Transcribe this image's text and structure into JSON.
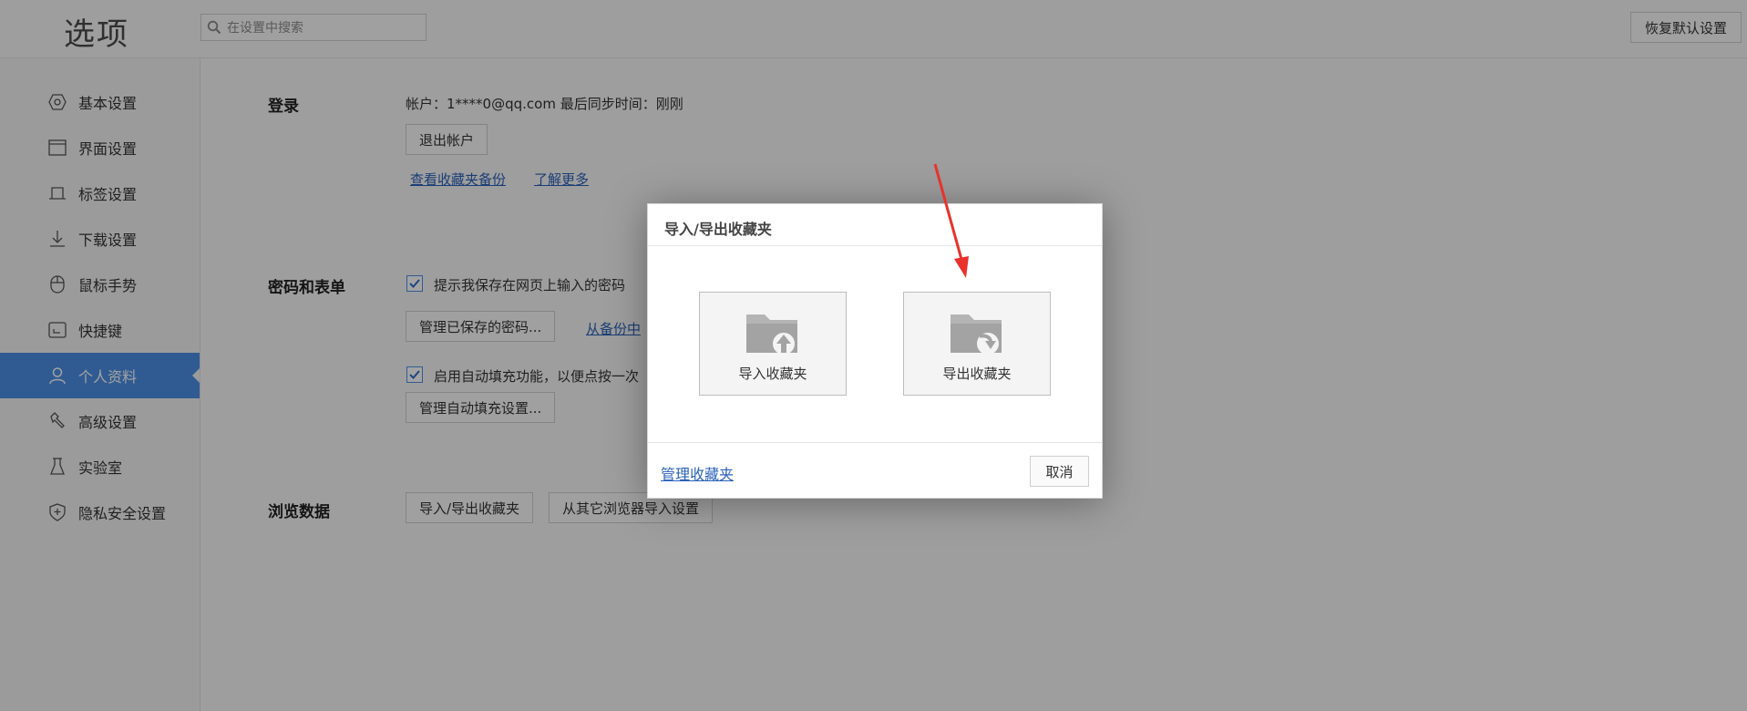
{
  "header": {
    "title": "选项",
    "search_placeholder": "在设置中搜索",
    "reset_label": "恢复默认设置"
  },
  "sidebar": {
    "items": [
      {
        "label": "基本设置",
        "icon": "hexagon-icon"
      },
      {
        "label": "界面设置",
        "icon": "window-icon"
      },
      {
        "label": "标签设置",
        "icon": "tab-icon"
      },
      {
        "label": "下载设置",
        "icon": "download-icon"
      },
      {
        "label": "鼠标手势",
        "icon": "mouse-icon"
      },
      {
        "label": "快捷键",
        "icon": "keyboard-shortcut-icon"
      },
      {
        "label": "个人资料",
        "icon": "user-icon",
        "active": true
      },
      {
        "label": "高级设置",
        "icon": "wrench-icon"
      },
      {
        "label": "实验室",
        "icon": "flask-icon"
      },
      {
        "label": "隐私安全设置",
        "icon": "shield-icon"
      }
    ]
  },
  "login": {
    "title": "登录",
    "account_text": "帐户：1****0@qq.com 最后同步时间：刚刚",
    "logout_label": "退出帐户",
    "view_backup_link": "查看收藏夹备份",
    "learn_more_link": "了解更多"
  },
  "password": {
    "title": "密码和表单",
    "save_prompt_label": "提示我保存在网页上输入的密码",
    "manage_passwords_label": "管理已保存的密码...",
    "restore_link": "从备份中",
    "autofill_label": "启用自动填充功能，以便点按一次",
    "manage_autofill_label": "管理自动填充设置..."
  },
  "browsing": {
    "title": "浏览数据",
    "import_export_label": "导入/导出收藏夹",
    "import_other_label": "从其它浏览器导入设置"
  },
  "dialog": {
    "title": "导入/导出收藏夹",
    "import_label": "导入收藏夹",
    "export_label": "导出收藏夹",
    "manage_link": "管理收藏夹",
    "cancel_label": "取消"
  },
  "colors": {
    "accent": "#4b8fe5",
    "link": "#2b61b8",
    "annotation_arrow": "#e8322b"
  }
}
